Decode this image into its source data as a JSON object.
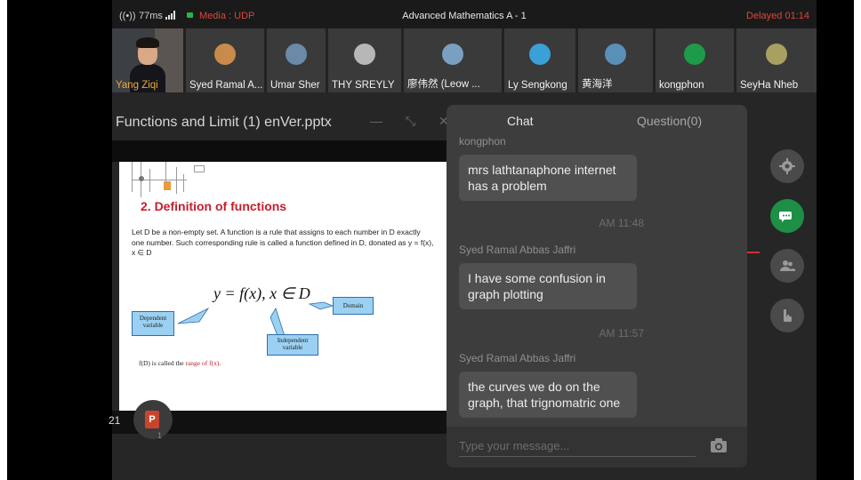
{
  "status_bar": {
    "signal": "((•))",
    "latency": "77ms",
    "media_label": "Media : UDP",
    "window_title": "Advanced Mathematics A - 1",
    "delayed": "Delayed 01:14"
  },
  "participants": [
    {
      "name": "Yang Ziqi",
      "camera": true
    },
    {
      "name": "Syed Ramal A...",
      "avatar_color": "#c98b4b"
    },
    {
      "name": "Umar Sher",
      "avatar_color": "#6b8aa8"
    },
    {
      "name": "THY SREYLY",
      "avatar_color": "#b7b7b7"
    },
    {
      "name": "廖伟然 (Leow ...",
      "avatar_color": "#7a9fc0"
    },
    {
      "name": "Ly Sengkong",
      "avatar_color": "#3aa0d8"
    },
    {
      "name": "黄海洋",
      "avatar_color": "#5a8fb8"
    },
    {
      "name": "kongphon",
      "avatar_color": "#1e9b4a"
    },
    {
      "name": "SeyHa Nheb",
      "avatar_color": "#a8a060"
    }
  ],
  "presentation": {
    "file_title": "Functions and Limit (1) enVer.pptx",
    "controls": [
      "—",
      "⤡",
      "✕"
    ],
    "slide": {
      "heading": "2. Definition of functions",
      "paragraph": "Let D be a non-empty set. A function is a rule that assigns to each number in D exactly one number. Such corresponding rule is called a function defined in D, donated as y = f(x), x ∈ D",
      "equation": "y = f(x), x ∈ D",
      "box_domain": "Domain",
      "box_dependent": "Dependent variable",
      "box_independent": "Independent variable",
      "range_text_prefix": "f(D) is called the ",
      "range_text_red": "range of f(x)",
      "range_text_suffix": "."
    },
    "page_number": "21",
    "ppt_count": "1",
    "ppt_letter": "P"
  },
  "chat": {
    "tab_chat": "Chat",
    "tab_question": "Question(0)",
    "messages": [
      {
        "sender": "kongphon",
        "text": "mrs lathtanaphone internet has a problem",
        "time": "AM 11:48"
      },
      {
        "sender": "Syed Ramal Abbas Jaffri",
        "text": "I have some confusion in graph plotting",
        "time": "AM 11:57"
      },
      {
        "sender": "Syed Ramal Abbas Jaffri",
        "text": "the curves we do on the graph, that trignomatric one"
      }
    ],
    "input_placeholder": "Type your message..."
  },
  "side_buttons": [
    "settings-icon",
    "chat-icon",
    "participants-icon",
    "raise-hand-icon"
  ],
  "colors": {
    "accent_green": "#1e8f46",
    "alert_red": "#e0443a",
    "panel_bg": "#3d3d3d"
  }
}
